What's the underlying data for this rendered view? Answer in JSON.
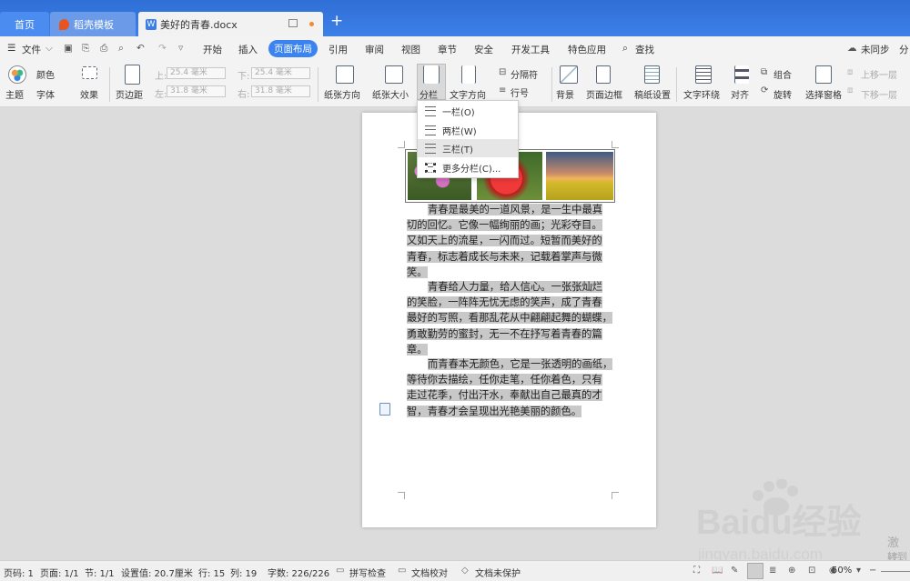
{
  "tabs": {
    "home": "首页",
    "template": "稻壳模板",
    "doc": "美好的青春.docx"
  },
  "menu": {
    "file": "文件",
    "items": [
      "开始",
      "插入",
      "页面布局",
      "引用",
      "审阅",
      "视图",
      "章节",
      "安全",
      "开发工具",
      "特色应用"
    ],
    "active": "页面布局",
    "search": "查找",
    "sync": "未同步",
    "share": "分"
  },
  "ribbon": {
    "theme": "主题",
    "color": "颜色",
    "font": "字体",
    "effect": "效果",
    "margin": "页边距",
    "top_label": "上:",
    "top_value": "25.4 毫米",
    "bottom_label": "下:",
    "bottom_value": "25.4 毫米",
    "left_label": "左:",
    "left_value": "31.8 毫米",
    "right_label": "右:",
    "right_value": "31.8 毫米",
    "orientation": "纸张方向",
    "size": "纸张大小",
    "columns": "分栏",
    "text_direction": "文字方向",
    "line_number": "行号",
    "separator": "分隔符",
    "background": "背景",
    "page_border": "页面边框",
    "manuscript": "稿纸设置",
    "text_wrap": "文字环绕",
    "align": "对齐",
    "rotate": "旋转",
    "group": "组合",
    "selection_pane": "选择窗格",
    "bring_forward": "上移一层",
    "send_backward": "下移一层"
  },
  "columns_menu": {
    "items": [
      "一栏(O)",
      "两栏(W)",
      "三栏(T)",
      "更多分栏(C)..."
    ],
    "highlighted": "三栏(T)"
  },
  "document": {
    "paragraphs": [
      [
        "青春是最美的一道风景，是一生中最真",
        "切的回忆。它像一幅绚丽的画；光彩夺目。",
        "又如天上的流星，一闪而过。短暂而美好的",
        "青春，标志着成长与未来，记载着掌声与微",
        "笑。"
      ],
      [
        "青春给人力量，给人信心。一张张灿烂",
        "的笑脸，一阵阵无忧无虑的笑声，成了青春",
        "最好的写照，看那乱花从中翩翩起舞的蝴蝶，",
        "勇敢勤劳的蜜封，无一不在抒写着青春的篇",
        "章。"
      ],
      [
        "而青春本无颜色，它是一张透明的画纸，",
        "等待你去描绘，任你走笔，任你着色，只有",
        "走过花季，付出汗水，奉献出自己最真的才",
        "智，青春才会呈现出光艳美丽的颜色。"
      ]
    ]
  },
  "status": {
    "page_no": "页码: 1",
    "pages": "页面: 1/1",
    "section": "节: 1/1",
    "setting": "设置值: 20.7厘米",
    "row": "行: 15",
    "col": "列: 19",
    "words": "字数: 226/226",
    "spell": "拼写检查",
    "proof": "文档校对",
    "protect": "文档未保护",
    "zoom": "50%"
  },
  "watermark": {
    "brand": "Baidu经验",
    "url": "jingyan.baidu.com",
    "activate": "激活",
    "goto": "转到"
  }
}
